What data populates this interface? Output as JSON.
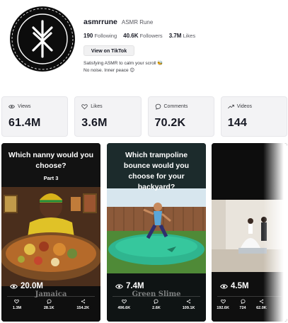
{
  "profile": {
    "username": "asmrrune",
    "nickname": "ASMR Rune",
    "following_count": "190",
    "following_label": "Following",
    "followers_count": "40.6K",
    "followers_label": "Followers",
    "likes_count": "3.7M",
    "likes_label": "Likes",
    "tiktok_button": "View on TikTok",
    "bio_line1": "Satisfying ASMR to calm your scroll 🐝",
    "bio_line2": "No noise. Inner peace 😊"
  },
  "stats": [
    {
      "icon": "eye-icon",
      "label": "Views",
      "value": "61.4M"
    },
    {
      "icon": "heart-icon",
      "label": "Likes",
      "value": "3.6M"
    },
    {
      "icon": "comment-icon",
      "label": "Comments",
      "value": "70.2K"
    },
    {
      "icon": "trend-icon",
      "label": "Videos",
      "value": "144"
    }
  ],
  "videos": [
    {
      "title": "Which nanny would you choose?",
      "subtitle": "Part 3",
      "views": "20.0M",
      "overlay_text": "Jamaica",
      "likes": "1.3M",
      "comments": "28.1K",
      "shares": "154.2K"
    },
    {
      "title": "Which trampoline bounce would you choose for your backyard?",
      "views": "7.4M",
      "overlay_text": "Green Slime",
      "likes": "496.6K",
      "comments": "2.6K",
      "shares": "109.1K"
    },
    {
      "views": "4.5M",
      "likes": "192.6K",
      "comments": "724",
      "shares": "62.0K"
    }
  ],
  "colors": {
    "text_primary": "#161823",
    "card_bg": "#f3f3f5",
    "slime_green": "#2fb58f"
  }
}
